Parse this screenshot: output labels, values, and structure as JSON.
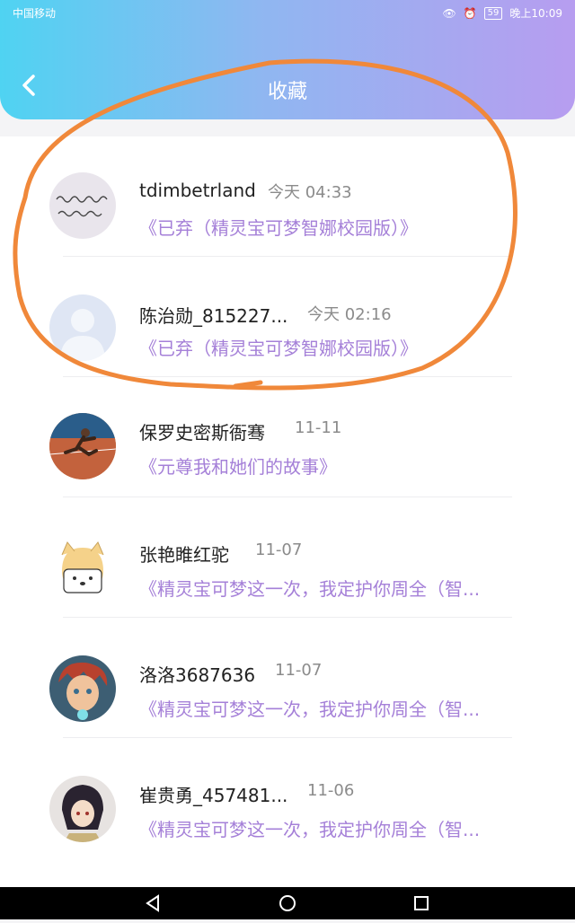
{
  "status": {
    "carrier": "中国移动",
    "battery": "59",
    "time": "晚上10:09"
  },
  "header": {
    "title": "收藏"
  },
  "items": [
    {
      "name": "tdimbetrland",
      "time": "今天 04:33",
      "subtitle": "《已弃（精灵宝可梦智娜校园版）》",
      "avatar": "handwriting-avatar"
    },
    {
      "name": "陈治勋_815227...",
      "time": "今天 02:16",
      "subtitle": "《已弃（精灵宝可梦智娜校园版）》",
      "avatar": "default-user-avatar"
    },
    {
      "name": "保罗史密斯衙骞",
      "time": "11-11",
      "subtitle": "《元尊我和她们的故事》",
      "avatar": "sprinter-avatar"
    },
    {
      "name": "张艳睢红驼",
      "time": "11-07",
      "subtitle": "《精灵宝可梦这一次，我定护你周全（智...",
      "avatar": "doge-avatar"
    },
    {
      "name": "洛洛3687636",
      "time": "11-07",
      "subtitle": "《精灵宝可梦这一次，我定护你周全（智...",
      "avatar": "cartoon-boy-avatar"
    },
    {
      "name": "崔贵勇_457481...",
      "time": "11-06",
      "subtitle": "《精灵宝可梦这一次，我定护你周全（智...",
      "avatar": "anime-avatar"
    }
  ],
  "annotation": {
    "color": "#f0883a"
  }
}
